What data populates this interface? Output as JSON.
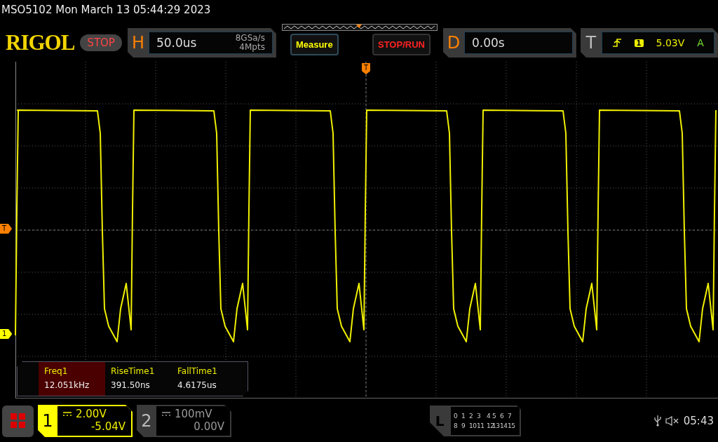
{
  "title": "MSO5102  Mon March 13 05:44:29 2023",
  "logo": "RIGOL",
  "run_state": "STOP",
  "horizontal": {
    "letter": "H",
    "timebase": "50.0us",
    "sample_rate": "8GSa/s",
    "memory_depth": "4Mpts"
  },
  "buttons": [
    {
      "label": "Measure",
      "kind": "menu"
    },
    {
      "label": "STOP/RUN",
      "kind": "run"
    }
  ],
  "delay": {
    "letter": "D",
    "value": "0.00s"
  },
  "trigger": {
    "letter": "T",
    "source": "1",
    "level": "5.03V",
    "mode": "A"
  },
  "markers": [
    {
      "label": "T",
      "kind": "trigger-position"
    },
    {
      "label": "T",
      "kind": "trigger-level"
    },
    {
      "label": "1",
      "kind": "channel"
    }
  ],
  "measurements": [
    {
      "name": "Freq1",
      "value": "12.051kHz",
      "selected": true
    },
    {
      "name": "RiseTime1",
      "value": "391.50ns",
      "selected": false
    },
    {
      "name": "FallTime1",
      "value": "4.6175us",
      "selected": false
    }
  ],
  "channels": [
    {
      "number": "1",
      "scale": "2.00V",
      "offset": "-5.04V",
      "on": true
    },
    {
      "number": "2",
      "scale": "100mV",
      "offset": "0.00V",
      "on": false
    }
  ],
  "logic": {
    "letter": "L",
    "rows": [
      [
        "0",
        "1",
        "2",
        "3",
        "4",
        "5",
        "6",
        "7"
      ],
      [
        "8",
        "9",
        "10",
        "11",
        "12",
        "13",
        "14",
        "15"
      ]
    ]
  },
  "status": {
    "time": "05:43"
  }
}
